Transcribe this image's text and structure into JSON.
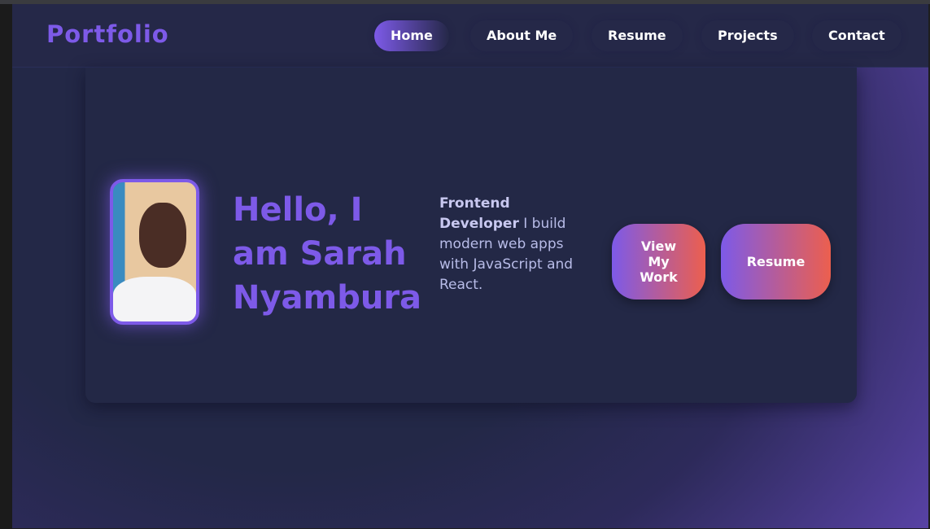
{
  "nav": {
    "logo": "Portfolio",
    "items": [
      {
        "label": "Home",
        "active": true
      },
      {
        "label": "About Me"
      },
      {
        "label": "Resume"
      },
      {
        "label": "Projects"
      },
      {
        "label": "Contact"
      }
    ]
  },
  "hero": {
    "greeting": "Hello, I am Sarah Nyambura",
    "role": "Frontend Developer",
    "description": " I build modern web apps with JavaScript and React.",
    "buttons": {
      "work": "View My Work",
      "resume": "Resume"
    }
  },
  "colors": {
    "accent": "#7d5ae8",
    "button_end": "#ec5f4e",
    "background": "#232846"
  }
}
